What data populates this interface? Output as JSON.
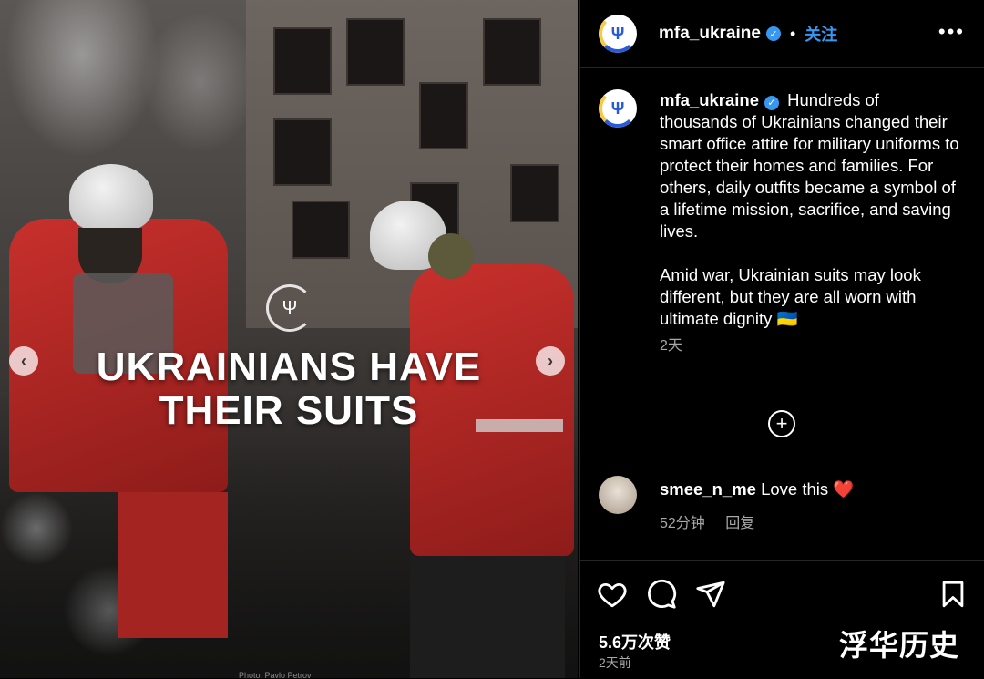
{
  "post_image": {
    "overlay_line1": "UKRAINIANS HAVE",
    "overlay_line2": "THEIR SUITS",
    "logo_symbol": "Ψ",
    "prev_icon": "chevron-left-icon",
    "next_icon": "chevron-right-icon",
    "prev_glyph": "‹",
    "next_glyph": "›",
    "photo_credit": "Photo: Pavlo Petrov"
  },
  "header": {
    "username": "mfa_ukraine",
    "verified_glyph": "✓",
    "separator": "•",
    "follow_label": "关注",
    "more_glyph": "•••"
  },
  "caption": {
    "username": "mfa_ukraine",
    "paragraph1": "Hundreds of thousands of Ukrainians changed their smart office attire for military uniforms to protect their homes and families. For others, daily outfits became a symbol of a lifetime mission, sacrifice, and saving lives.",
    "paragraph2": "Amid war, Ukrainian suits may look different, but they are all worn with ultimate dignity",
    "flag_emoji": "🇺🇦",
    "time": "2天"
  },
  "load_more_glyph": "+",
  "comment": {
    "username": "smee_n_me",
    "text": "Love this",
    "emoji": "❤️",
    "time": "52分钟",
    "reply_label": "回复"
  },
  "actions": {
    "likes": "5.6万次赞",
    "post_time": "2天前"
  },
  "watermark": "浮华历史",
  "colors": {
    "accent": "#3897f0",
    "muted": "#a8a8a8",
    "background": "#000000",
    "jacket_red": "#c8302c"
  }
}
